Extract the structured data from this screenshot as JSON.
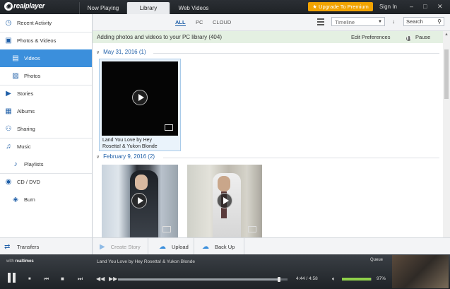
{
  "app": {
    "logo_text": "realplayer"
  },
  "topbar": {
    "tabs": [
      "Now Playing",
      "Library",
      "Web Videos"
    ],
    "active_tab": "Library",
    "upgrade_label": "Upgrade To Premium",
    "signin_label": "Sign In"
  },
  "sidebar": {
    "items": [
      {
        "label": "Recent Activity",
        "icon": "clock-icon"
      },
      {
        "label": "Photos & Videos",
        "icon": "media-icon"
      },
      {
        "label": "Videos",
        "icon": "film-icon",
        "active": true
      },
      {
        "label": "Photos",
        "icon": "photo-icon"
      },
      {
        "label": "Stories",
        "icon": "stories-icon"
      },
      {
        "label": "Albums",
        "icon": "albums-icon"
      },
      {
        "label": "Sharing",
        "icon": "people-icon"
      },
      {
        "label": "Music",
        "icon": "music-note-icon"
      },
      {
        "label": "Playlists",
        "icon": "playlist-icon"
      },
      {
        "label": "CD / DVD",
        "icon": "disc-icon"
      },
      {
        "label": "Burn",
        "icon": "burn-icon"
      }
    ],
    "transfers_label": "Transfers"
  },
  "toolbar": {
    "filters": [
      "ALL",
      "PC",
      "CLOUD"
    ],
    "active_filter": "ALL",
    "view_select": "Timeline",
    "search_placeholder": "Search"
  },
  "notice": {
    "text": "Adding photos and videos to your PC library (404)",
    "edit_label": "Edit Preferences",
    "pause_label": "Pause"
  },
  "groups": [
    {
      "label": "May 31, 2016 (1)",
      "items": [
        {
          "caption_line1": "Land You Love   by    Hey",
          "caption_line2": "Rosetta! & Yukon Blonde"
        }
      ]
    },
    {
      "label": "February 9, 2016 (2)",
      "items": [
        {},
        {}
      ]
    }
  ],
  "bottom_actions": [
    "Create Story",
    "Upload",
    "Back Up"
  ],
  "player": {
    "with_label": "with",
    "brand": "realtimes",
    "now_playing": "Land You Love   by    Hey Rosetta! & Yukon Blonde",
    "queue_label": "Queue",
    "time": "4:44 / 4:58",
    "volume": "97%",
    "progress": 0.95,
    "volume_level": 0.97
  },
  "colors": {
    "accent": "#3b8fdc",
    "upgrade": "#f2a300",
    "notice_bg": "#e4f0e2"
  }
}
